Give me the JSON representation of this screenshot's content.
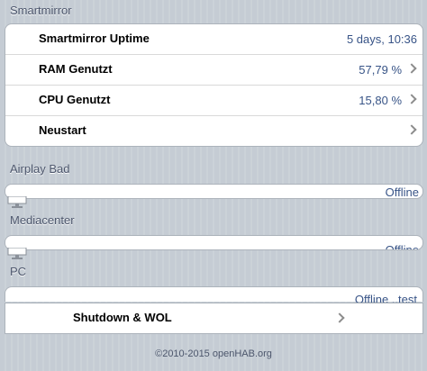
{
  "sections": {
    "smartmirror": {
      "title": "Smartmirror",
      "rows": [
        {
          "label": "Smartmirror Uptime",
          "value": "5 days, 10:36"
        },
        {
          "label": "RAM Genutzt",
          "value": "57,79 %"
        },
        {
          "label": "CPU Genutzt",
          "value": "15,80 %"
        },
        {
          "label": "Neustart",
          "value": ""
        }
      ]
    },
    "airplay": {
      "title": "Airplay Bad",
      "status": "Offline",
      "icon": "tv-icon"
    },
    "mediacenter": {
      "title": "Mediacenter",
      "status": "Offline",
      "icon": "tv-icon"
    },
    "pc": {
      "title": "PC",
      "status": "Offline ..test",
      "action_label": "Shutdown & WOL"
    }
  },
  "footer": "©2010-2015 openHAB.org",
  "colors": {
    "background": "#c5ccd4",
    "value_text": "#385487",
    "section_label": "#4c566c"
  }
}
